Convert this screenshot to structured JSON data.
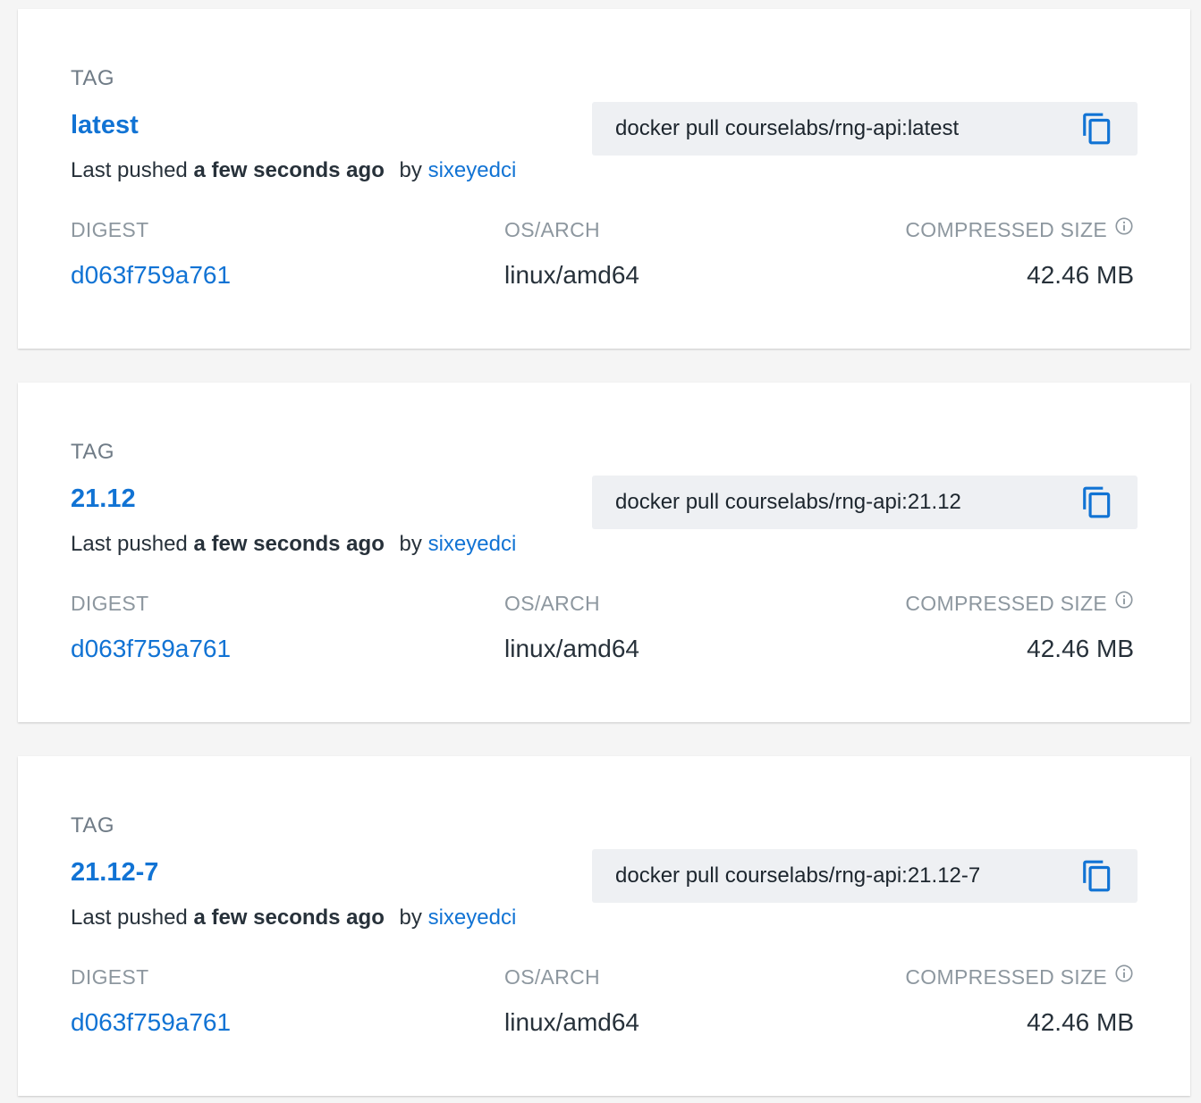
{
  "tags": [
    {
      "section_label": "TAG",
      "name": "latest",
      "pushed_prefix": "Last pushed",
      "pushed_time": "a few seconds ago",
      "by_label": "by",
      "pusher": "sixeyedci",
      "pull_command": "docker pull courselabs/rng-api:latest",
      "digest_label": "DIGEST",
      "digest": "d063f759a761",
      "osarch_label": "OS/ARCH",
      "osarch": "linux/amd64",
      "size_label": "COMPRESSED SIZE",
      "size": "42.46 MB"
    },
    {
      "section_label": "TAG",
      "name": "21.12",
      "pushed_prefix": "Last pushed",
      "pushed_time": "a few seconds ago",
      "by_label": "by",
      "pusher": "sixeyedci",
      "pull_command": "docker pull courselabs/rng-api:21.12",
      "digest_label": "DIGEST",
      "digest": "d063f759a761",
      "osarch_label": "OS/ARCH",
      "osarch": "linux/amd64",
      "size_label": "COMPRESSED SIZE",
      "size": "42.46 MB"
    },
    {
      "section_label": "TAG",
      "name": "21.12-7",
      "pushed_prefix": "Last pushed",
      "pushed_time": "a few seconds ago",
      "by_label": "by",
      "pusher": "sixeyedci",
      "pull_command": "docker pull courselabs/rng-api:21.12-7",
      "digest_label": "DIGEST",
      "digest": "d063f759a761",
      "osarch_label": "OS/ARCH",
      "osarch": "linux/amd64",
      "size_label": "COMPRESSED SIZE",
      "size": "42.46 MB"
    }
  ],
  "icons": {
    "copy": "copy-icon",
    "info": "info-icon"
  },
  "colors": {
    "link": "#1173d4",
    "page_bg": "#f5f5f5",
    "card_bg": "#ffffff",
    "pull_box_bg": "#eef0f3",
    "muted_label": "#8d979f"
  }
}
